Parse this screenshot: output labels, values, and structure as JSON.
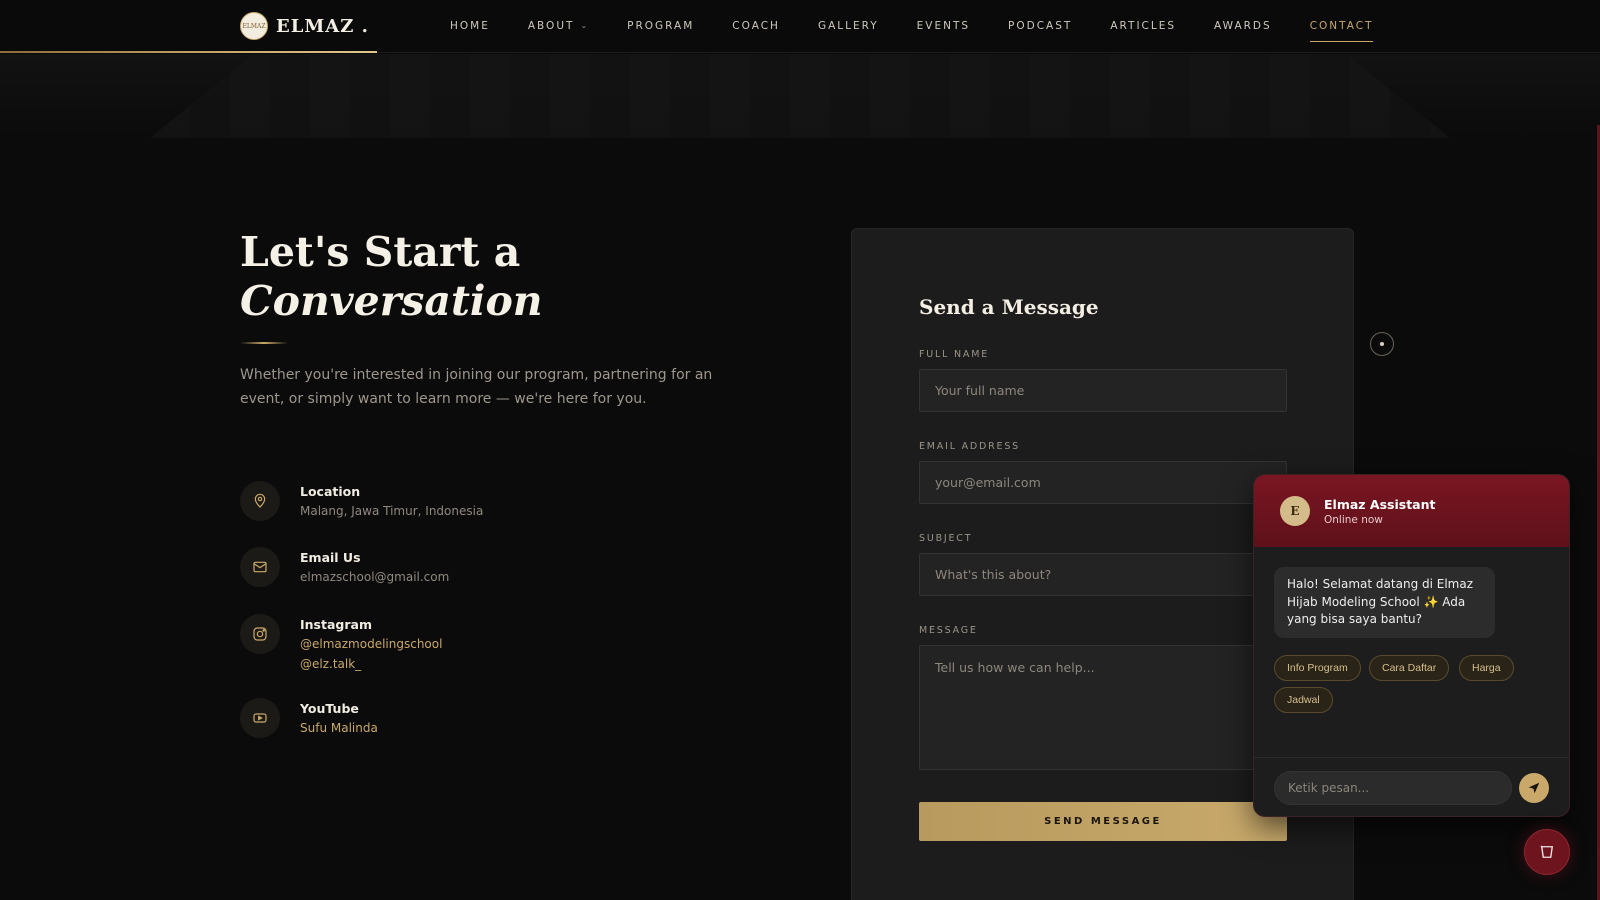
{
  "brand": {
    "logo_text": "ELMAZ",
    "name": "ELMAZ ."
  },
  "nav": {
    "items": [
      {
        "label": "HOME"
      },
      {
        "label": "ABOUT",
        "has_dropdown": true
      },
      {
        "label": "PROGRAM"
      },
      {
        "label": "COACH"
      },
      {
        "label": "GALLERY"
      },
      {
        "label": "EVENTS"
      },
      {
        "label": "PODCAST"
      },
      {
        "label": "ARTICLES"
      },
      {
        "label": "AWARDS"
      },
      {
        "label": "CONTACT",
        "active": true
      }
    ]
  },
  "hero": {
    "heading_line1": "Let's Start a",
    "heading_line2": "Conversation",
    "intro": "Whether you're interested in joining our program, partnering for an event, or simply want to learn more — we're here for you."
  },
  "contacts": [
    {
      "icon": "map-pin-icon",
      "title": "Location",
      "values": [
        "Malang, Jawa Timur, Indonesia"
      ]
    },
    {
      "icon": "mail-icon",
      "title": "Email Us",
      "values": [
        "elmazschool@gmail.com"
      ]
    },
    {
      "icon": "instagram-icon",
      "title": "Instagram",
      "values": [
        "@elmazmodelingschool",
        "@elz.talk_"
      ]
    },
    {
      "icon": "youtube-icon",
      "title": "YouTube",
      "values": [
        "Sufu Malinda"
      ]
    }
  ],
  "form": {
    "title": "Send a Message",
    "full_name": {
      "label": "FULL NAME",
      "placeholder": "Your full name",
      "value": ""
    },
    "email": {
      "label": "EMAIL ADDRESS",
      "placeholder": "your@email.com",
      "value": ""
    },
    "subject": {
      "label": "SUBJECT",
      "placeholder": "What's this about?",
      "value": ""
    },
    "message": {
      "label": "MESSAGE",
      "placeholder": "Tell us how we can help...",
      "value": ""
    },
    "submit_label": "SEND MESSAGE"
  },
  "chat": {
    "avatar_letter": "E",
    "name": "Elmaz Assistant",
    "status": "Online now",
    "greeting": "Halo! Selamat datang di Elmaz Hijab Modeling School ✨ Ada yang bisa saya bantu?",
    "chips": [
      "Info Program",
      "Cara Daftar",
      "Harga",
      "Jadwal"
    ],
    "input_placeholder": "Ketik pesan..."
  },
  "colors": {
    "background": "#0b0b0b",
    "accent_gold": "#c9a86a",
    "chat_header": "#7a1622",
    "card": "#1c1c1c"
  }
}
